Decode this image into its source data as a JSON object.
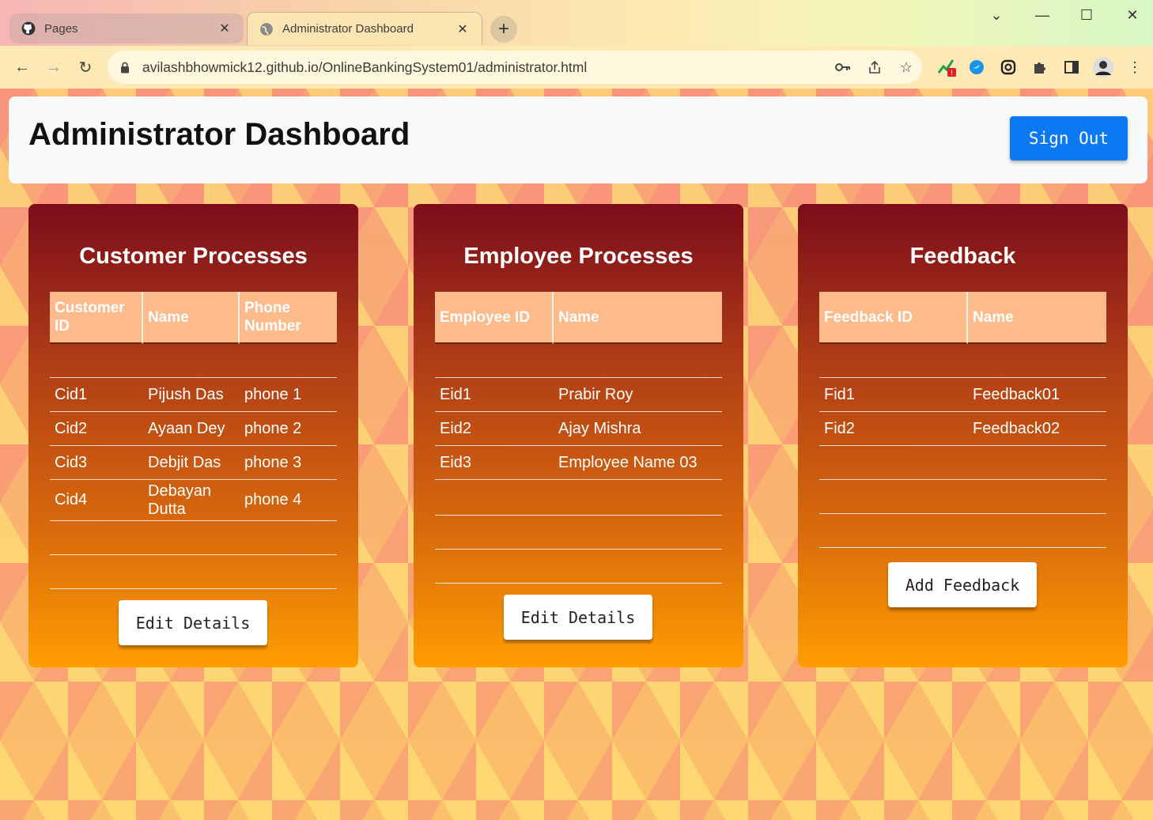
{
  "browser": {
    "tabs": [
      {
        "label": "Pages",
        "icon": "github-icon"
      },
      {
        "label": "Administrator Dashboard",
        "icon": "globe-icon"
      }
    ],
    "url": "avilashbhowmick12.github.io/OnlineBankingSystem01/administrator.html"
  },
  "header": {
    "title": "Administrator Dashboard",
    "signout_label": "Sign Out"
  },
  "customer": {
    "title": "Customer Processes",
    "columns": [
      "Customer ID",
      "Name",
      "Phone Number"
    ],
    "rows": [
      [
        "Cid1",
        "Pijush Das",
        "phone 1"
      ],
      [
        "Cid2",
        "Ayaan Dey",
        "phone 2"
      ],
      [
        "Cid3",
        "Debjit Das",
        "phone 3"
      ],
      [
        "Cid4",
        "Debayan Dutta",
        "phone 4"
      ]
    ],
    "button": "Edit Details"
  },
  "employee": {
    "title": "Employee Processes",
    "columns": [
      "Employee ID",
      "Name"
    ],
    "rows": [
      [
        "Eid1",
        "Prabir Roy"
      ],
      [
        "Eid2",
        "Ajay Mishra"
      ],
      [
        "Eid3",
        "Employee Name 03"
      ]
    ],
    "button": "Edit Details"
  },
  "feedback": {
    "title": "Feedback",
    "columns": [
      "Feedback ID",
      "Name"
    ],
    "rows": [
      [
        "Fid1",
        "Feedback01"
      ],
      [
        "Fid2",
        "Feedback02"
      ]
    ],
    "button": "Add Feedback"
  },
  "colors": {
    "primary_button": "#0b79f4",
    "table_header": "#fdbb8c",
    "card_top": "#7c0c1a",
    "card_bottom": "#ff9d00"
  }
}
